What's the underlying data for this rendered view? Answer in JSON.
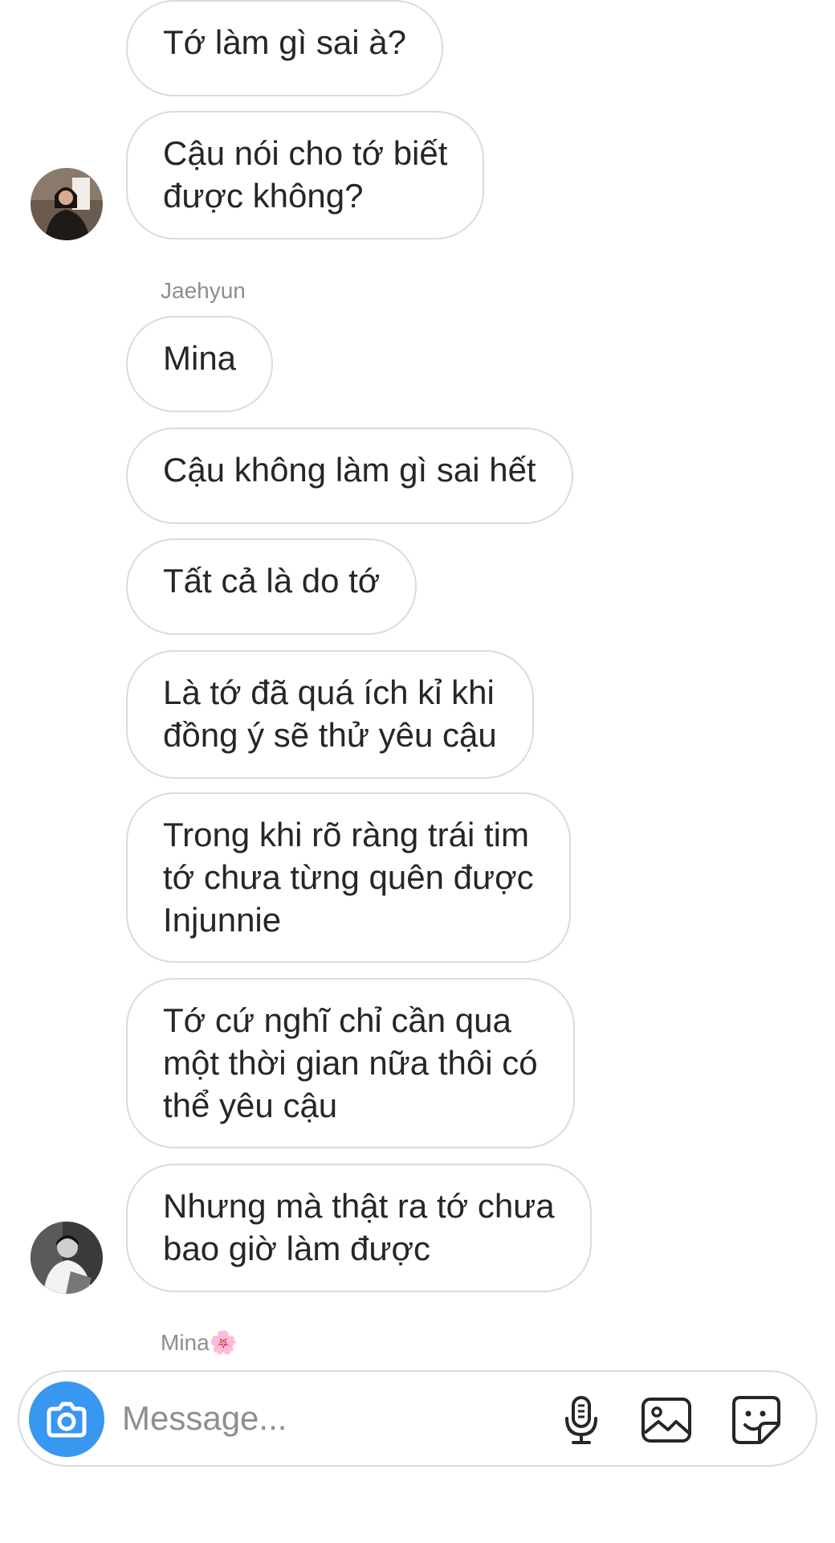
{
  "messages": [
    {
      "text": "Tớ làm gì sai à?"
    },
    {
      "text": "Cậu nói cho tớ biết\nđược không?"
    },
    {
      "text": "Mina"
    },
    {
      "text": "Cậu không làm gì sai hết"
    },
    {
      "text": "Tất cả là do tớ"
    },
    {
      "text": "Là tớ đã quá ích kỉ khi\nđồng ý sẽ thử yêu cậu"
    },
    {
      "text": "Trong khi rõ ràng trái tim\ntớ chưa từng quên được\nInjunnie"
    },
    {
      "text": "Tớ cứ nghĩ chỉ cần qua\nmột thời gian nữa thôi có\nthể yêu cậu"
    },
    {
      "text": "Nhưng mà thật ra tớ chưa\nbao giờ làm được"
    }
  ],
  "senders": {
    "jaehyun": "Jaehyun",
    "mina": "Mina🌸"
  },
  "composer": {
    "placeholder": "Message..."
  },
  "icons": {
    "camera": "camera-icon",
    "mic": "microphone-icon",
    "gallery": "gallery-icon",
    "sticker": "sticker-icon"
  },
  "colors": {
    "accent": "#3897f0",
    "bubble_border": "#dbdbdb",
    "text": "#262626",
    "muted": "#8e8e8e"
  }
}
